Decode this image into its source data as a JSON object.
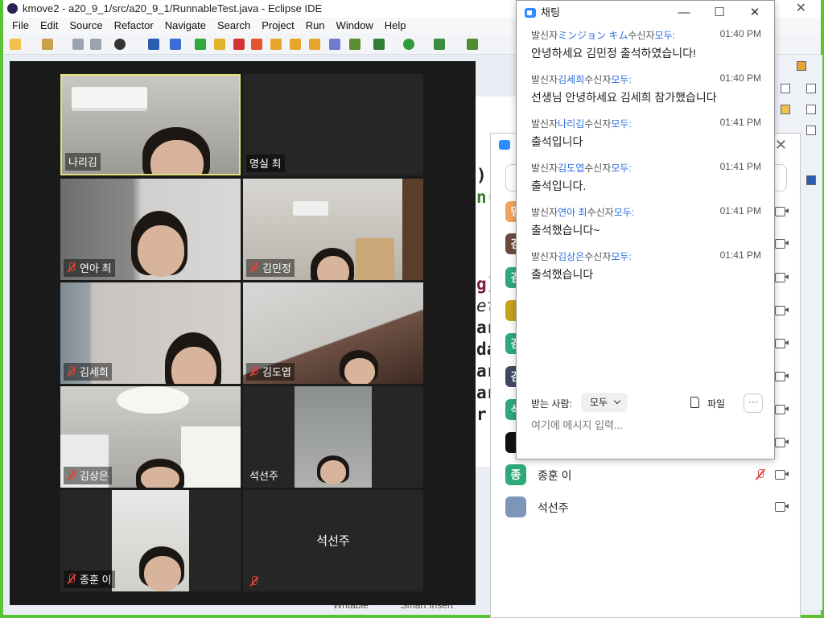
{
  "eclipse": {
    "title": "kmove2 - a20_9_1/src/a20_9_1/RunnableTest.java - Eclipse IDE",
    "menu": [
      "File",
      "Edit",
      "Source",
      "Refactor",
      "Navigate",
      "Search",
      "Project",
      "Run",
      "Window",
      "Help"
    ],
    "code_fragments": [
      ")",
      "n(",
      "g)",
      "et",
      "ar",
      "da",
      "ar",
      "ar",
      "r."
    ],
    "status": [
      "Writable",
      "Smart Insert"
    ]
  },
  "gallery": {
    "tiles": [
      {
        "name": "나리김",
        "muted": false,
        "video": true
      },
      {
        "name": "명실 최",
        "muted": false,
        "video": false
      },
      {
        "name": "연아 최",
        "muted": true,
        "video": true
      },
      {
        "name": "김민정",
        "muted": true,
        "video": true
      },
      {
        "name": "김세희",
        "muted": true,
        "video": true
      },
      {
        "name": "김도엽",
        "muted": true,
        "video": true
      },
      {
        "name": "김상은",
        "muted": true,
        "video": true
      },
      {
        "name": "석선주",
        "muted": false,
        "video": true
      },
      {
        "name": "종훈 이",
        "muted": true,
        "video": true
      },
      {
        "name": "석선주",
        "muted": true,
        "video": false
      }
    ],
    "center_name": "석선주"
  },
  "participants": {
    "rows": [
      {
        "initial": "명",
        "color": "#f0a35e",
        "name": ""
      },
      {
        "initial": "김",
        "color": "#6b4b3e",
        "name": ""
      },
      {
        "initial": "김",
        "color": "#2fa97a",
        "name": ""
      },
      {
        "initial": "",
        "color": "#c7a21a",
        "name": ""
      },
      {
        "initial": "김",
        "color": "#2fa97a",
        "name": ""
      },
      {
        "initial": "김",
        "color": "#3b4a63",
        "name": ""
      },
      {
        "initial": "석",
        "color": "#2fa97a",
        "name": ""
      },
      {
        "initial": "",
        "color": "#111111",
        "name": ""
      },
      {
        "initial": "종",
        "color": "#2fa97a",
        "name": "종훈 이"
      },
      {
        "initial": "",
        "color": "#7d96b8",
        "name": "석선주"
      }
    ]
  },
  "chat": {
    "title": "채팅",
    "sender_prefix": "발신자",
    "receiver_prefix": "수신자",
    "messages": [
      {
        "sender": "ミンジョン キム",
        "receiver": "모두:",
        "time": "01:40 PM",
        "text": "안녕하세요 김민정 출석하였습니다!"
      },
      {
        "sender": "김세희",
        "receiver": "모두:",
        "time": "01:40 PM",
        "text": "선생님 안녕하세요 김세희 참가했습니다"
      },
      {
        "sender": "나리김",
        "receiver": "모두:",
        "time": "01:41 PM",
        "text": "출석입니다"
      },
      {
        "sender": "김도엽",
        "receiver": "모두:",
        "time": "01:41 PM",
        "text": "출석입니다."
      },
      {
        "sender": "연아 최",
        "receiver": "모두:",
        "time": "01:41 PM",
        "text": "출석했습니다~"
      },
      {
        "sender": "김상은",
        "receiver": "모두:",
        "time": "01:41 PM",
        "text": "출석했습니다"
      }
    ],
    "receiver_label": "받는 사람:",
    "receiver_value": "모두",
    "file_label": "파일",
    "more_label": "···",
    "input_placeholder": "여기에 메시지 입력..."
  },
  "colors": {
    "zoom_blue": "#2d8cff",
    "mute_red": "#e0433a",
    "active_speaker": "#e6e07a",
    "link_blue": "#2d6cdf"
  }
}
